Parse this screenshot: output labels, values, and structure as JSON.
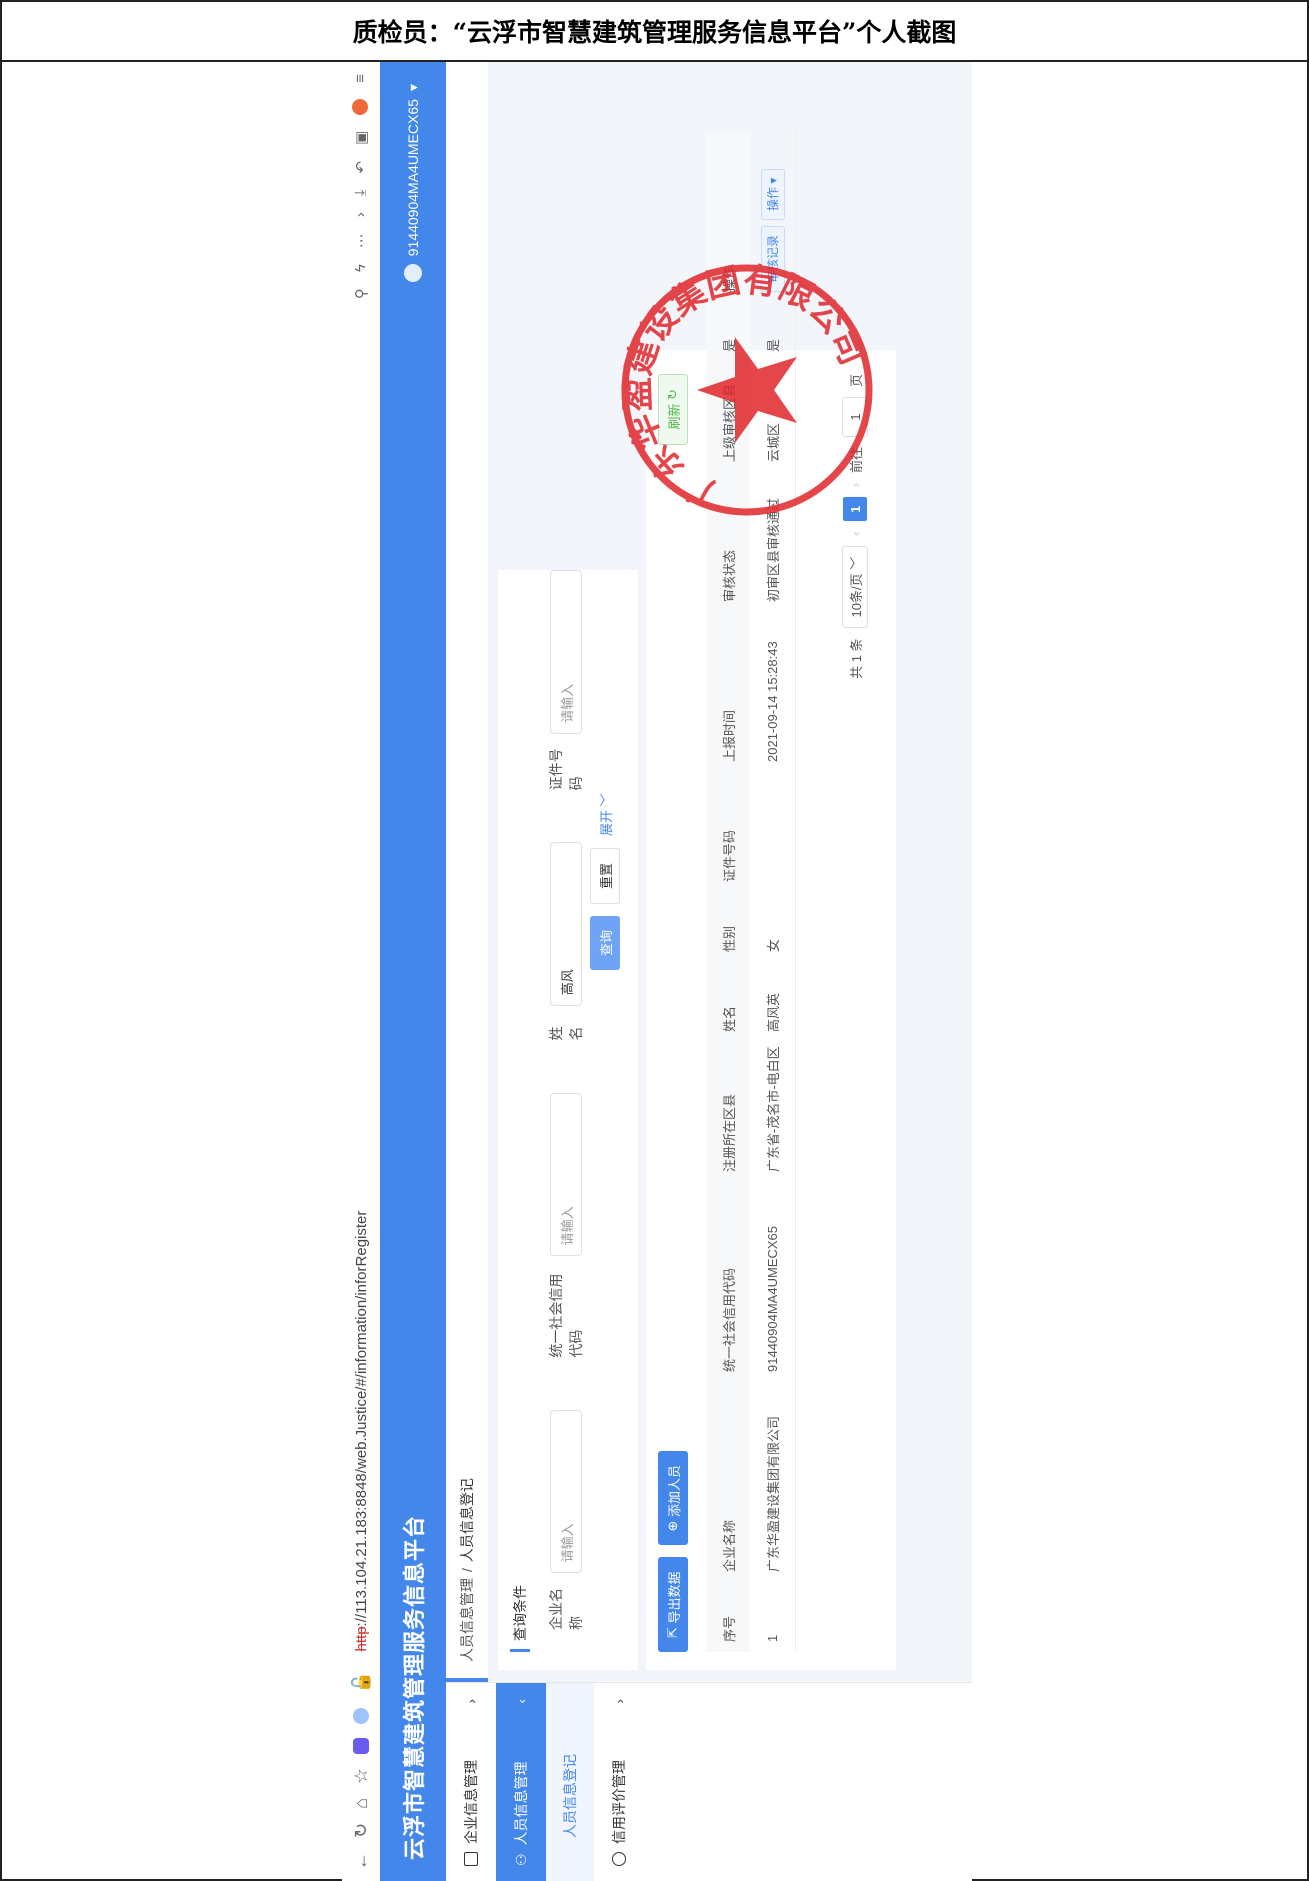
{
  "document": {
    "heading": "质检员：“云浮市智慧建筑管理服务信息平台”个人截图"
  },
  "browser": {
    "url_proto": "http",
    "url_rest": "://113.104.21.183:8848/web.Justice/#/information/inforRegister"
  },
  "app": {
    "title": "云浮市智慧建筑管理服务信息平台",
    "user_code": "91440904MA4UMECX65"
  },
  "sidebar": {
    "items": [
      {
        "label": "企业信息管理"
      },
      {
        "label": "人员信息管理"
      },
      {
        "label": "人员信息登记"
      },
      {
        "label": "信用评价管理"
      }
    ]
  },
  "breadcrumb": {
    "parent": "人员信息管理",
    "sep": "/",
    "current": "人员信息登记"
  },
  "filter": {
    "title": "查询条件",
    "company_label": "企业名称",
    "company_placeholder": "请输入",
    "credit_label": "统一社会信用代码",
    "credit_placeholder": "请输入",
    "name_label": "姓名",
    "name_value": "高风",
    "id_label": "证件号码",
    "id_placeholder": "请输入",
    "search": "查询",
    "reset": "重置",
    "expand": "展开"
  },
  "toolbar": {
    "export": "导出数据",
    "add": "添加人员",
    "refresh": "刷新"
  },
  "table": {
    "columns": [
      "序号",
      "企业名称",
      "统一社会信用代码",
      "注册所在区县",
      "姓名",
      "性别",
      "证件号码",
      "上报时间",
      "审核状态",
      "上级审核区县",
      "是",
      "操作"
    ],
    "rows": [
      {
        "index": "1",
        "company": "广东华盈建设集团有限公司",
        "credit_code": "91440904MA4UMECX65",
        "district": "广东省-茂名市-电白区",
        "name": "高风英",
        "gender": "女",
        "id_no": "",
        "report_time": "2021-09-14 15:28:43",
        "status": "初审区县审核通过",
        "upper_district": "云城区",
        "flag": "是",
        "op_record": "审核记录",
        "op_more": "操作"
      }
    ]
  },
  "pager": {
    "total": "共 1 条",
    "size": "10条/页",
    "page": "1",
    "goto": "前往",
    "goto_value": "1",
    "unit": "页"
  },
  "seal": {
    "text": "广东华盈建设集团有限公司",
    "color": "#e0262b"
  },
  "colors": {
    "primary": "#4387ea",
    "redaction": "#4e80bd"
  }
}
